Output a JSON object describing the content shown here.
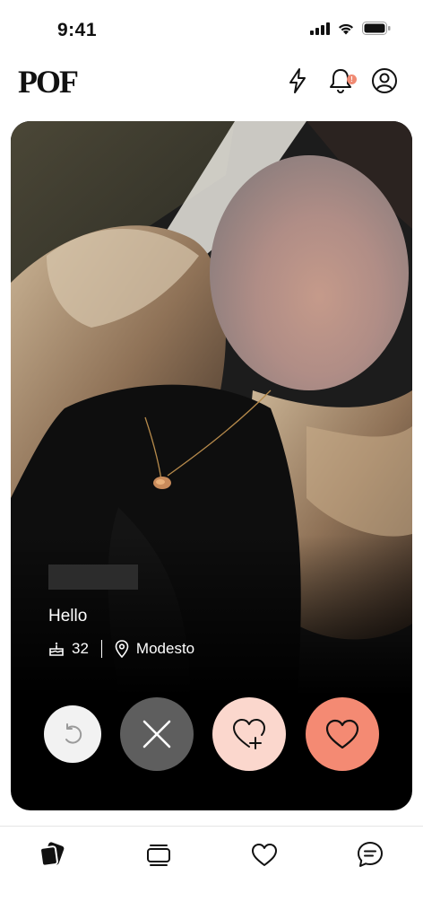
{
  "status_bar": {
    "time": "9:41"
  },
  "header": {
    "logo": "POF",
    "notification_badge": "!"
  },
  "profile": {
    "bio": "Hello",
    "age": "32",
    "location": "Modesto"
  },
  "colors": {
    "accent": "#f48a73",
    "accent_light": "#fbd7cd",
    "pass_button": "#5e5e5e",
    "card_bg": "#000000"
  },
  "icons": {
    "header": [
      "boost-icon",
      "bell-icon",
      "profile-icon"
    ],
    "actions": [
      "undo-icon",
      "close-icon",
      "super-like-icon",
      "heart-icon"
    ],
    "nav": [
      "cards-icon",
      "stack-icon",
      "heart-outline-icon",
      "chat-icon"
    ]
  }
}
